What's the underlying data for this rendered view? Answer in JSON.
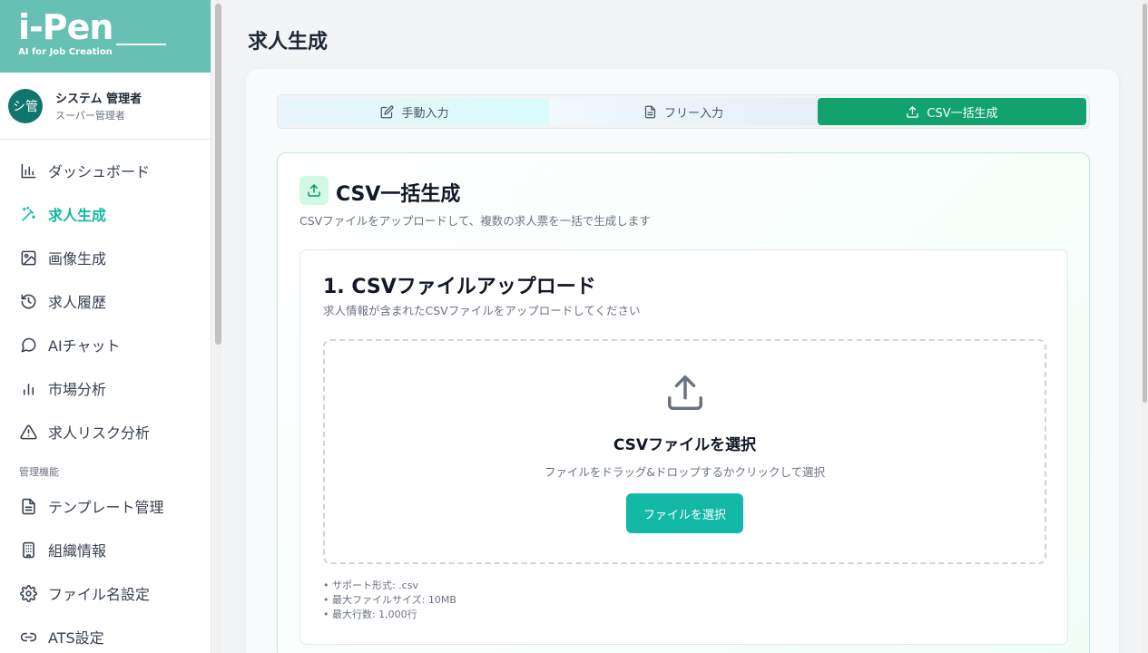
{
  "brand": {
    "logo": "i-Pen",
    "tagline": "AI for Job Creation",
    "color": "#67c0b4"
  },
  "user": {
    "avatar": "シ管",
    "name": "システム 管理者",
    "role": "スーパー管理者"
  },
  "nav": {
    "items": [
      {
        "label": "ダッシュボード",
        "icon": "bar-chart-icon"
      },
      {
        "label": "求人生成",
        "icon": "magic-wand-icon",
        "active": true
      },
      {
        "label": "画像生成",
        "icon": "image-icon"
      },
      {
        "label": "求人履歴",
        "icon": "history-icon"
      },
      {
        "label": "AIチャット",
        "icon": "chat-bubble-icon"
      },
      {
        "label": "市場分析",
        "icon": "bar-chart-simple-icon"
      },
      {
        "label": "求人リスク分析",
        "icon": "warning-triangle-icon"
      }
    ],
    "admin_section": "管理機能",
    "admin_items": [
      {
        "label": "テンプレート管理",
        "icon": "document-icon"
      },
      {
        "label": "組織情報",
        "icon": "building-icon"
      },
      {
        "label": "ファイル名設定",
        "icon": "gear-icon"
      },
      {
        "label": "ATS設定",
        "icon": "link-icon"
      }
    ]
  },
  "page": {
    "title": "求人生成"
  },
  "tabs": [
    {
      "label": "手動入力",
      "icon": "edit-icon"
    },
    {
      "label": "フリー入力",
      "icon": "file-text-icon"
    },
    {
      "label": "CSV一括生成",
      "icon": "upload-icon",
      "active": true
    }
  ],
  "csv": {
    "title": "CSV一括生成",
    "description": "CSVファイルをアップロードして、複数の求人票を一括で生成します",
    "upload": {
      "title": "1. CSVファイルアップロード",
      "subtitle": "求人情報が含まれたCSVファイルをアップロードしてください",
      "dropzone_title": "CSVファイルを選択",
      "dropzone_sub": "ファイルをドラッグ&ドロップするかクリックして選択",
      "button": "ファイルを選択",
      "notes": [
        "• サポート形式: .csv",
        "• 最大ファイルサイズ: 10MB",
        "• 最大行数: 1,000行"
      ]
    }
  },
  "colors": {
    "accent": "#14b8a6",
    "tab_active": "#12a26d"
  }
}
